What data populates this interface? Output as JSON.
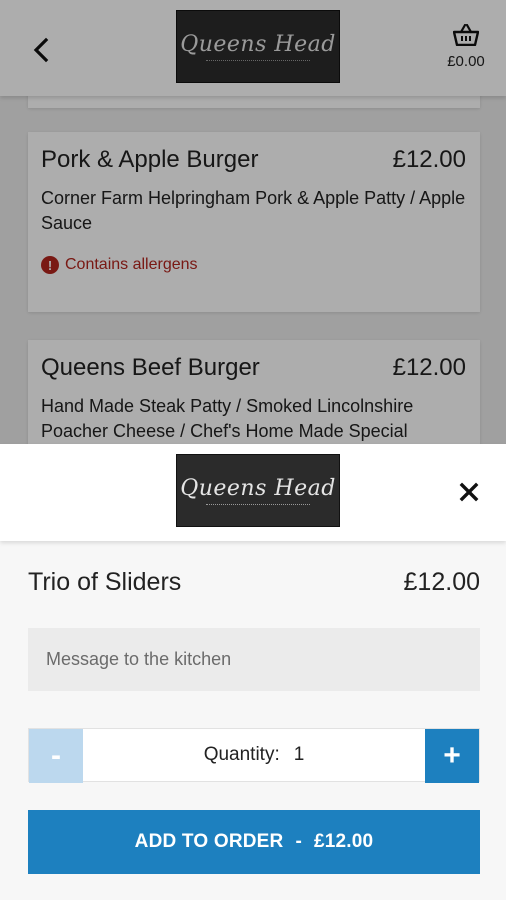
{
  "header": {
    "logo_text": "Queens Head",
    "basket_total": "£0.00"
  },
  "menu": {
    "items": [
      {
        "name": "Pork & Apple Burger",
        "price": "£12.00",
        "description": "Corner Farm Helpringham Pork & Apple Patty / Apple Sauce",
        "allergen_label": "Contains allergens"
      },
      {
        "name": "Queens Beef Burger",
        "price": "£12.00",
        "description": "Hand Made Steak Patty / Smoked Lincolnshire Poacher Cheese / Chef's Home Made Special"
      }
    ]
  },
  "sheet": {
    "logo_text": "Queens Head",
    "item_name": "Trio of Sliders",
    "item_price": "£12.00",
    "message_placeholder": "Message to the kitchen",
    "quantity_label": "Quantity:",
    "quantity_value": "1",
    "minus_label": "-",
    "plus_label": "+",
    "add_button_label": "ADD TO ORDER",
    "add_button_separator": "-",
    "add_button_price": "£12.00"
  },
  "colors": {
    "accent": "#1d80bf",
    "accent_disabled": "#bcd8ee",
    "allergen": "#b3261e"
  },
  "icons": {
    "back": "chevron-left-icon",
    "basket": "basket-icon",
    "close": "close-icon",
    "allergen": "alert-icon"
  }
}
